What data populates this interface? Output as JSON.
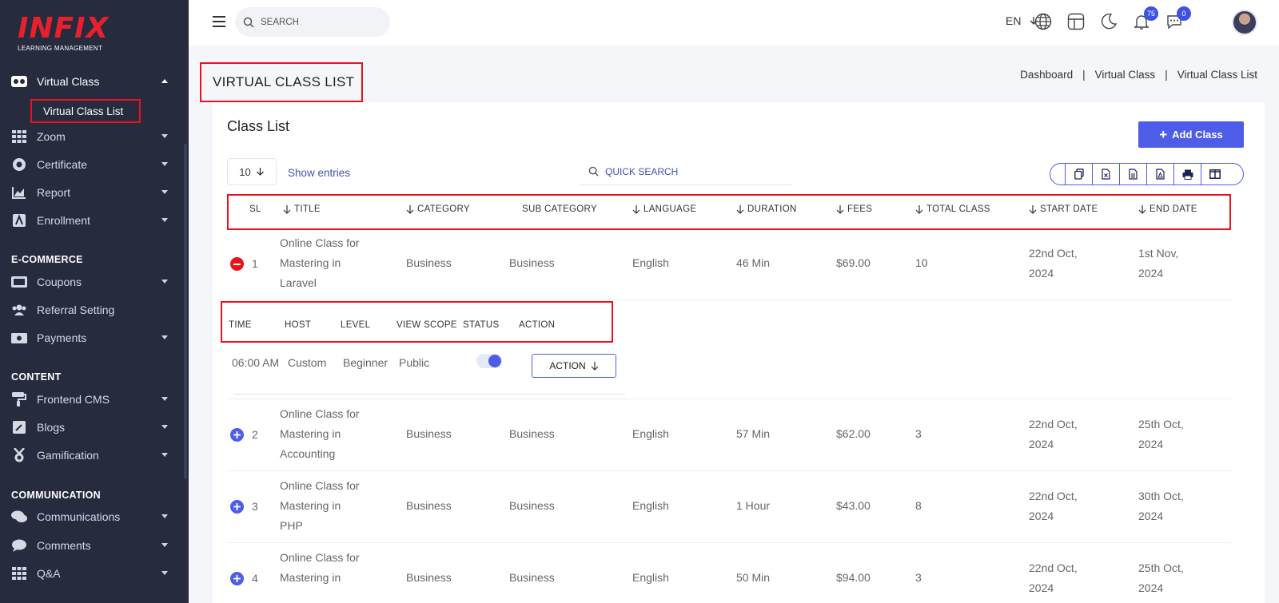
{
  "brand": {
    "logo": "INFIX",
    "tagline": "LEARNING MANAGEMENT"
  },
  "sidebar": {
    "items": [
      {
        "label": "Virtual Class",
        "icon": "vr-icon",
        "expanded": true
      },
      {
        "label": "Zoom",
        "icon": "grid-icon"
      },
      {
        "label": "Certificate",
        "icon": "certificate-icon"
      },
      {
        "label": "Report",
        "icon": "chart-icon"
      },
      {
        "label": "Enrollment",
        "icon": "enrollment-icon"
      },
      {
        "label": "Coupons",
        "icon": "coupon-icon"
      },
      {
        "label": "Referral Setting",
        "icon": "users-icon"
      },
      {
        "label": "Payments",
        "icon": "money-icon"
      },
      {
        "label": "Frontend CMS",
        "icon": "paint-roller-icon"
      },
      {
        "label": "Blogs",
        "icon": "edit-icon"
      },
      {
        "label": "Gamification",
        "icon": "medal-icon"
      },
      {
        "label": "Communications",
        "icon": "comments-icon"
      },
      {
        "label": "Comments",
        "icon": "comment-icon"
      },
      {
        "label": "Q&A",
        "icon": "grid-icon"
      }
    ],
    "subitem": "Virtual Class List",
    "sections": {
      "ecommerce": "E-COMMERCE",
      "content": "CONTENT",
      "communication": "COMMUNICATION"
    }
  },
  "topbar": {
    "search_placeholder": "SEARCH",
    "language": "EN",
    "notifications_count": "75",
    "messages_count": "0"
  },
  "page": {
    "title": "VIRTUAL CLASS LIST",
    "breadcrumb": [
      "Dashboard",
      "Virtual Class",
      "Virtual Class List"
    ]
  },
  "card": {
    "title": "Class List",
    "add_button": "Add Class",
    "entries_value": "10",
    "entries_label": "Show entries",
    "quick_search_placeholder": "QUICK SEARCH",
    "export_buttons": [
      "copy-icon",
      "excel-icon",
      "csv-icon",
      "pdf-icon",
      "print-icon",
      "columns-icon"
    ]
  },
  "table": {
    "columns": [
      "SL",
      "TITLE",
      "CATEGORY",
      "SUB CATEGORY",
      "LANGUAGE",
      "DURATION",
      "FEES",
      "TOTAL CLASS",
      "START DATE",
      "END DATE"
    ],
    "rows": [
      {
        "sl": "1",
        "title": [
          "Online Class for",
          "Mastering in",
          "Laravel"
        ],
        "category": "Business",
        "subcategory": "Business",
        "language": "English",
        "duration": "46 Min",
        "fees": "$69.00",
        "total": "10",
        "start": [
          "22nd Oct,",
          "2024"
        ],
        "end": [
          "1st Nov,",
          "2024"
        ],
        "expanded": true
      },
      {
        "sl": "2",
        "title": [
          "Online Class for",
          "Mastering in",
          "Accounting"
        ],
        "category": "Business",
        "subcategory": "Business",
        "language": "English",
        "duration": "57 Min",
        "fees": "$62.00",
        "total": "3",
        "start": [
          "22nd Oct,",
          "2024"
        ],
        "end": [
          "25th Oct,",
          "2024"
        ]
      },
      {
        "sl": "3",
        "title": [
          "Online Class for",
          "Mastering in",
          "PHP"
        ],
        "category": "Business",
        "subcategory": "Business",
        "language": "English",
        "duration": "1 Hour",
        "fees": "$43.00",
        "total": "8",
        "start": [
          "22nd Oct,",
          "2024"
        ],
        "end": [
          "30th Oct,",
          "2024"
        ]
      },
      {
        "sl": "4",
        "title": [
          "Online Class for",
          "Mastering in",
          ""
        ],
        "category": "Business",
        "subcategory": "Business",
        "language": "English",
        "duration": "50 Min",
        "fees": "$94.00",
        "total": "3",
        "start": [
          "22nd Oct,",
          "2024"
        ],
        "end": [
          "25th Oct,",
          "2024"
        ]
      }
    ],
    "child": {
      "columns": [
        "TIME",
        "HOST",
        "LEVEL",
        "VIEW SCOPE",
        "STATUS",
        "ACTION"
      ],
      "time": "06:00 AM",
      "host": "Custom",
      "level": "Beginner",
      "view_scope": "Public",
      "status_on": true,
      "action_label": "ACTION"
    }
  },
  "colors": {
    "sidebar_bg": "#262b3e",
    "accent": "#4d5de8",
    "highlight_red": "#e8131d",
    "brand_red": "#e8202e"
  }
}
